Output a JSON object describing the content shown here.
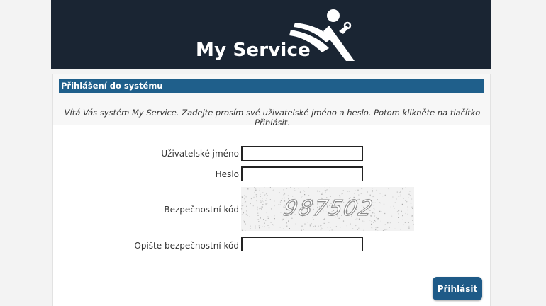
{
  "banner": {
    "brand": "My Service"
  },
  "login": {
    "section_title": "Přihlášení do systému",
    "welcome_text": "Vítá Vás systém My Service. Zadejte prosím své uživatelské jméno a heslo. Potom klikněte na tlačítko Přihlásit.",
    "username_label": "Uživatelské jméno",
    "username_value": "",
    "password_label": "Heslo",
    "password_value": "",
    "captcha_label": "Bezpečnostní kód",
    "captcha_code": "987502",
    "captcha_input_label": "Opište bezpečnostní kód",
    "captcha_input_value": "",
    "submit_label": "Přihlásit"
  },
  "colors": {
    "banner_bg": "#1a2533",
    "header_bg": "#1f5f8b",
    "button_bg": "#1e5a87"
  }
}
